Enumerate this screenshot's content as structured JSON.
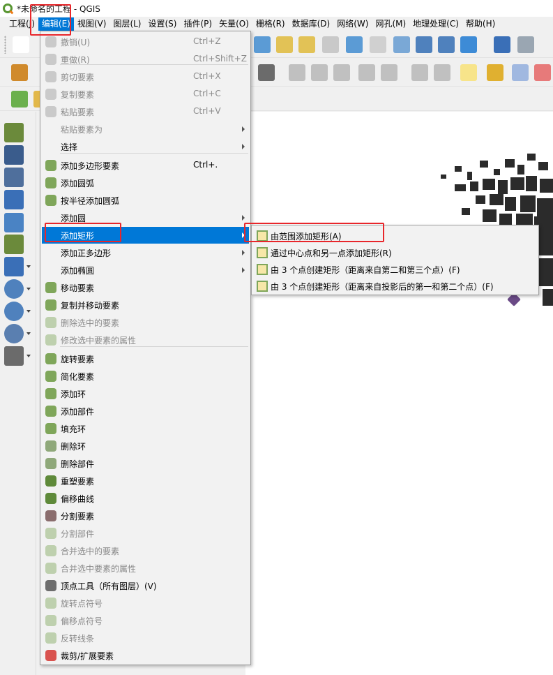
{
  "window": {
    "title": "*未命名的工程 - QGIS"
  },
  "menubar": [
    {
      "label": "工程(J)"
    },
    {
      "label": "编辑(E)"
    },
    {
      "label": "视图(V)"
    },
    {
      "label": "图层(L)"
    },
    {
      "label": "设置(S)"
    },
    {
      "label": "插件(P)"
    },
    {
      "label": "矢量(O)"
    },
    {
      "label": "栅格(R)"
    },
    {
      "label": "数据库(D)"
    },
    {
      "label": "网络(W)"
    },
    {
      "label": "网孔(M)"
    },
    {
      "label": "地理处理(C)"
    },
    {
      "label": "帮助(H)"
    }
  ],
  "edit_menu": {
    "items": [
      {
        "label": "撤销(U)",
        "shortcut": "Ctrl+Z",
        "enabled": false,
        "icon": "undo-icon"
      },
      {
        "label": "重做(R)",
        "shortcut": "Ctrl+Shift+Z",
        "enabled": false,
        "icon": "redo-icon"
      },
      {
        "label": "剪切要素",
        "shortcut": "Ctrl+X",
        "enabled": false,
        "icon": "cut-icon"
      },
      {
        "label": "复制要素",
        "shortcut": "Ctrl+C",
        "enabled": false,
        "icon": "copy-icon"
      },
      {
        "label": "粘贴要素",
        "shortcut": "Ctrl+V",
        "enabled": false,
        "icon": "paste-icon"
      },
      {
        "label": "粘贴要素为",
        "shortcut": "",
        "enabled": false,
        "submenu": true
      },
      {
        "label": "选择",
        "shortcut": "",
        "enabled": true,
        "submenu": true
      },
      {
        "label": "添加多边形要素",
        "shortcut": "Ctrl+.",
        "enabled": true,
        "icon": "add-polygon-icon"
      },
      {
        "label": "添加圆弧",
        "shortcut": "",
        "enabled": true,
        "icon": "add-arc-icon"
      },
      {
        "label": "按半径添加圆弧",
        "shortcut": "",
        "enabled": true,
        "icon": "add-arc-radius-icon"
      },
      {
        "label": "添加圆",
        "shortcut": "",
        "enabled": true,
        "submenu": true
      },
      {
        "label": "添加矩形",
        "shortcut": "",
        "enabled": true,
        "submenu": true,
        "selected": true
      },
      {
        "label": "添加正多边形",
        "shortcut": "",
        "enabled": true,
        "submenu": true
      },
      {
        "label": "添加椭圆",
        "shortcut": "",
        "enabled": true,
        "submenu": true
      },
      {
        "label": "移动要素",
        "shortcut": "",
        "enabled": true,
        "icon": "move-feature-icon"
      },
      {
        "label": "复制并移动要素",
        "shortcut": "",
        "enabled": true,
        "icon": "copy-move-feature-icon"
      },
      {
        "label": "删除选中的要素",
        "shortcut": "",
        "enabled": false,
        "icon": "delete-selected-icon"
      },
      {
        "label": "修改选中要素的属性",
        "shortcut": "",
        "enabled": false,
        "icon": "modify-attributes-icon"
      },
      {
        "label": "旋转要素",
        "shortcut": "",
        "enabled": true,
        "icon": "rotate-feature-icon"
      },
      {
        "label": "简化要素",
        "shortcut": "",
        "enabled": true,
        "icon": "simplify-feature-icon"
      },
      {
        "label": "添加环",
        "shortcut": "",
        "enabled": true,
        "icon": "add-ring-icon"
      },
      {
        "label": "添加部件",
        "shortcut": "",
        "enabled": true,
        "icon": "add-part-icon"
      },
      {
        "label": "填充环",
        "shortcut": "",
        "enabled": true,
        "icon": "fill-ring-icon"
      },
      {
        "label": "删除环",
        "shortcut": "",
        "enabled": true,
        "icon": "delete-ring-icon"
      },
      {
        "label": "删除部件",
        "shortcut": "",
        "enabled": true,
        "icon": "delete-part-icon"
      },
      {
        "label": "重塑要素",
        "shortcut": "",
        "enabled": true,
        "icon": "reshape-feature-icon"
      },
      {
        "label": "偏移曲线",
        "shortcut": "",
        "enabled": true,
        "icon": "offset-curve-icon"
      },
      {
        "label": "分割要素",
        "shortcut": "",
        "enabled": true,
        "icon": "split-feature-icon"
      },
      {
        "label": "分割部件",
        "shortcut": "",
        "enabled": false,
        "icon": "split-part-icon"
      },
      {
        "label": "合并选中的要素",
        "shortcut": "",
        "enabled": false,
        "icon": "merge-features-icon"
      },
      {
        "label": "合并选中要素的属性",
        "shortcut": "",
        "enabled": false,
        "icon": "merge-attributes-icon"
      },
      {
        "label": "顶点工具（所有图层）(V)",
        "shortcut": "",
        "enabled": true,
        "icon": "vertex-tool-icon"
      },
      {
        "label": "旋转点符号",
        "shortcut": "",
        "enabled": false,
        "icon": "rotate-point-symbol-icon"
      },
      {
        "label": "偏移点符号",
        "shortcut": "",
        "enabled": false,
        "icon": "offset-point-symbol-icon"
      },
      {
        "label": "反转线条",
        "shortcut": "",
        "enabled": false,
        "icon": "reverse-line-icon"
      },
      {
        "label": "裁剪/扩展要素",
        "shortcut": "",
        "enabled": true,
        "icon": "trim-extend-icon"
      }
    ]
  },
  "rectangle_submenu": {
    "items": [
      {
        "label": "由范围添加矩形(A)",
        "icon": "rectangle-extent-icon"
      },
      {
        "label": "通过中心点和另一点添加矩形(R)",
        "icon": "rectangle-center-icon"
      },
      {
        "label": "由 3 个点创建矩形（距离来自第二和第三个点）(F)",
        "icon": "rectangle-3points-distance-icon"
      },
      {
        "label": "由 3 个点创建矩形（距离来自投影后的第一和第二个点）(F)",
        "icon": "rectangle-3points-projected-icon"
      }
    ]
  },
  "colors": {
    "accent": "#0078d7",
    "highlight_box": "#e8262b",
    "menu_bg": "#f2f2f2",
    "disabled_text": "#8a8a8a"
  }
}
